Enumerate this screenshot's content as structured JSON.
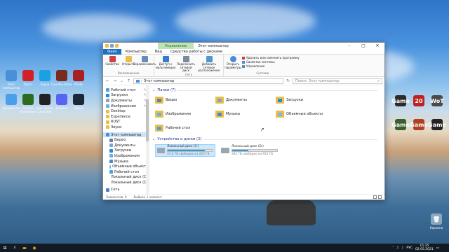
{
  "desktop": {
    "left_icons": [
      {
        "label": "Этот компьютер",
        "icon": "computer-icon",
        "color": "#4a90d9"
      },
      {
        "label": "Opera",
        "icon": "opera-icon",
        "color": "#d0202a"
      },
      {
        "label": "Skype",
        "icon": "skype-icon",
        "color": "#1ba1e2"
      },
      {
        "label": "Counter-Strike",
        "icon": "game-icon",
        "color": "#7a2b20"
      },
      {
        "label": "Photo",
        "icon": "photo-icon",
        "color": "#a82020"
      },
      {
        "label": "Документы",
        "icon": "folder-icon",
        "color": "#4aa0e8"
      },
      {
        "label": "GeForce Experience",
        "icon": "nvidia-icon",
        "color": "#2d6b1f"
      },
      {
        "label": "Epic Games Launcher",
        "icon": "epic-icon",
        "color": "#222222"
      },
      {
        "label": "Discord",
        "icon": "discord-icon",
        "color": "#5865f2"
      },
      {
        "label": "Steam",
        "icon": "steam-icon",
        "color": "#1b2838"
      }
    ],
    "right_icons": [
      {
        "label": "Game",
        "icon": "game-icon",
        "color": "#2b2b2b"
      },
      {
        "label": "20",
        "icon": "game-icon",
        "color": "#c02020"
      },
      {
        "label": "WoT",
        "icon": "game-icon",
        "color": "#4a4a4a"
      },
      {
        "label": "Game",
        "icon": "game-icon",
        "color": "#3b5f2b"
      },
      {
        "label": "Game",
        "icon": "game-icon",
        "color": "#b04020"
      },
      {
        "label": "Game",
        "icon": "game-icon",
        "color": "#222222"
      }
    ],
    "recycle_bin": "Корзина"
  },
  "window": {
    "context_tab": "Управление",
    "title": "Этот компьютер",
    "tabs": [
      "Файл",
      "Компьютер",
      "Вид",
      "Средства работы с дисками"
    ],
    "ribbon": {
      "location": {
        "label": "Расположение",
        "buttons": [
          "Свойства",
          "Открыть",
          "Переименовать"
        ]
      },
      "network": {
        "label": "Сеть",
        "buttons": [
          "Доступ к мультимедиа",
          "Подключить сетевой диск",
          "Добавить сетевое расположение"
        ]
      },
      "system": {
        "label": "Система",
        "open_params": "Открыть параметры",
        "items": [
          "Удалить или изменить программу",
          "Свойства системы",
          "Управление"
        ]
      }
    },
    "address": {
      "path": "Этот компьютер",
      "search_placeholder": "Поиск: Этот компьютер"
    },
    "sidebar": [
      {
        "label": "Рабочий стол",
        "icon": "folder-blue-icon",
        "pinned": true
      },
      {
        "label": "Загрузки",
        "icon": "download-icon",
        "pinned": true
      },
      {
        "label": "Документы",
        "icon": "documents-icon",
        "pinned": true
      },
      {
        "label": "Изображения",
        "icon": "pictures-icon",
        "pinned": true
      },
      {
        "label": "Desktop",
        "icon": "folder-icon",
        "pinned": false
      },
      {
        "label": "Experience",
        "icon": "folder-icon",
        "pinned": false
      },
      {
        "label": "RUST",
        "icon": "folder-icon",
        "pinned": false
      },
      {
        "label": "Звуки",
        "icon": "folder-icon",
        "pinned": false
      },
      {
        "label": "Этот компьютер",
        "icon": "computer-icon",
        "pinned": false,
        "selected": true
      },
      {
        "label": "Видео",
        "icon": "video-icon",
        "pinned": false
      },
      {
        "label": "Документы",
        "icon": "documents-icon",
        "pinned": false
      },
      {
        "label": "Загрузки",
        "icon": "download-icon",
        "pinned": false
      },
      {
        "label": "Изображения",
        "icon": "pictures-icon",
        "pinned": false
      },
      {
        "label": "Музыка",
        "icon": "music-icon",
        "pinned": false
      },
      {
        "label": "Объемные объекты",
        "icon": "3d-objects-icon",
        "pinned": false
      },
      {
        "label": "Рабочий стол",
        "icon": "folder-blue-icon",
        "pinned": false
      },
      {
        "label": "Локальный диск (C:)",
        "icon": "drive-icon",
        "pinned": false
      },
      {
        "label": "Локальный диск (D:)",
        "icon": "drive-icon",
        "pinned": false
      },
      {
        "label": "Сеть",
        "icon": "network-icon",
        "pinned": false
      }
    ],
    "folders_header": "Папки (7)",
    "folders": [
      {
        "label": "Видео",
        "accent": "#5a7fb0"
      },
      {
        "label": "Документы",
        "accent": "#8aa0bc"
      },
      {
        "label": "Загрузки",
        "accent": "#2a8ad8"
      },
      {
        "label": "Изображения",
        "accent": "#6ab0e0"
      },
      {
        "label": "Музыка",
        "accent": "#4a88c8"
      },
      {
        "label": "Объемные объекты",
        "accent": "#7ab8e8"
      },
      {
        "label": "Рабочий стол",
        "accent": "#4aa0e8"
      }
    ],
    "drives_header": "Устройства и диски (2)",
    "drives": [
      {
        "label": "Локальный диск (C:)",
        "free": "37,4 ГБ свободно из 223 ГБ",
        "used_pct": 83,
        "selected": true
      },
      {
        "label": "Локальный диск (D:)",
        "free": "592 ГБ свободно из 931 ГБ",
        "used_pct": 36,
        "selected": false
      }
    ],
    "status": {
      "count": "Элементов: 9",
      "selected": "Выбран 1 элемент"
    }
  },
  "taskbar": {
    "lang": "РУС",
    "time": "15:35",
    "date": "02.05.2021"
  }
}
